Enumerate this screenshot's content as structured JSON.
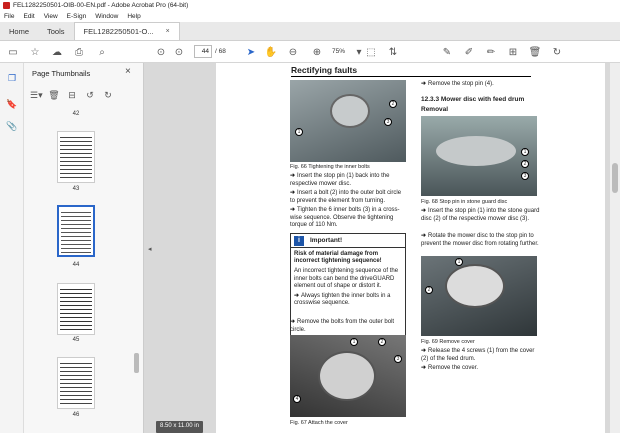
{
  "window": {
    "title": "FEL1282250501-OIB-00-EN.pdf - Adobe Acrobat Pro (64-bit)"
  },
  "menu": [
    "File",
    "Edit",
    "View",
    "E-Sign",
    "Window",
    "Help"
  ],
  "tabs": {
    "home": "Home",
    "tools": "Tools",
    "doc": "FEL1282250501-O...",
    "close": "×"
  },
  "toolbar": {
    "page_current": "44",
    "page_count": "/ 68",
    "zoom": "75%"
  },
  "panel": {
    "title": "Page Thumbnails",
    "close": "×",
    "thumbnails": [
      {
        "label": "42"
      },
      {
        "label": "43"
      },
      {
        "label": "44",
        "selected": true
      },
      {
        "label": "45"
      },
      {
        "label": "46"
      }
    ]
  },
  "viewer": {
    "page_size": "8.50 x 11.00 in"
  },
  "doc": {
    "heading": "Rectifying faults",
    "fig66_caption": "Fig. 66    Tightening the inner bolts",
    "left_bullets": [
      "Insert the stop pin (1) back into the respective mower disc.",
      "Insert a bolt (2) into the outer bolt circle to prevent the element from turning.",
      "Tighten the 6 inner bolts (3) in a cross-wise sequence. Observe the tightening torque of 110 Nm."
    ],
    "warning": {
      "icon": "i",
      "title": "Important!",
      "subtitle": "Risk of material damage from incorrect tightening sequence!",
      "text": "An incorrect tightening sequence of the inner bolts can bend the driveGUARD element out of shape or distort it.",
      "bullet": "Always tighten the inner bolts in a crosswise sequence."
    },
    "remove_bolts": "Remove the bolts from the outer bolt circle.",
    "fig67_caption": "Fig. 67    Attach the cover",
    "right_top_bullet": "Remove the stop pin (4).",
    "section_title": "12.3.3 Mower disc with feed drum",
    "removal": "Removal",
    "fig68_caption": "Fig. 68    Stop pin in stone guard disc",
    "right_bullets": [
      "Insert the stop pin (1) into the stone guard disc (2) of the respective mower disc (3).",
      "Rotate the mower disc to the stop pin to prevent the mower disc from rotating further."
    ],
    "fig69_caption": "Fig. 69    Remove cover",
    "right_bottom_bullets": [
      "Release the 4 screws (1) from the cover (2) of the feed drum.",
      "Remove the cover."
    ],
    "callouts_fig66": [
      "1",
      "2",
      "3"
    ],
    "callouts_fig67": [
      "1",
      "2",
      "3",
      "4"
    ],
    "callouts_fig68": [
      "1",
      "2",
      "3"
    ],
    "callouts_fig69": [
      "1",
      "2"
    ]
  }
}
